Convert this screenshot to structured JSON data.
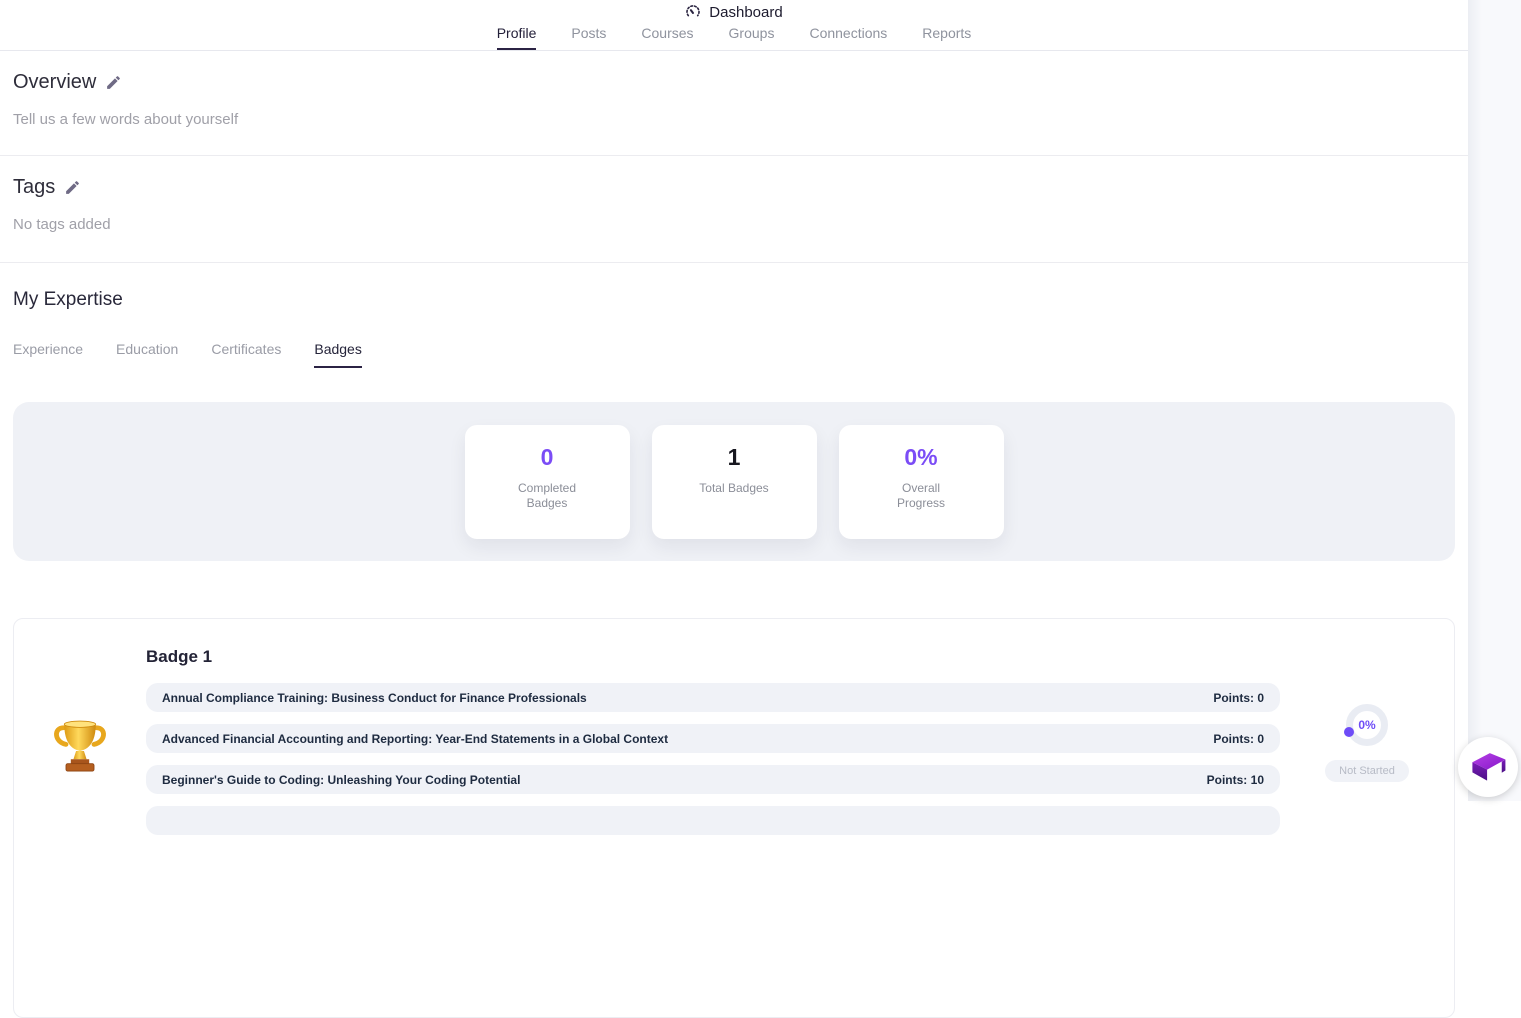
{
  "header": {
    "title": "Dashboard",
    "tabs": [
      {
        "label": "Profile"
      },
      {
        "label": "Posts"
      },
      {
        "label": "Courses"
      },
      {
        "label": "Groups"
      },
      {
        "label": "Connections"
      },
      {
        "label": "Reports"
      }
    ]
  },
  "overview": {
    "title": "Overview",
    "subtitle": "Tell us a few words about yourself"
  },
  "tags": {
    "title": "Tags",
    "empty_text": "No tags added"
  },
  "expertise": {
    "title": "My Expertise",
    "tabs": [
      {
        "label": "Experience"
      },
      {
        "label": "Education"
      },
      {
        "label": "Certificates"
      },
      {
        "label": "Badges"
      }
    ],
    "stats": [
      {
        "value": "0",
        "label": "Completed Badges"
      },
      {
        "value": "1",
        "label": "Total Badges"
      },
      {
        "value": "0%",
        "label": "Overall Progress"
      }
    ]
  },
  "badge": {
    "title": "Badge 1",
    "courses": [
      {
        "title": "Annual Compliance Training: Business Conduct for Finance Professionals",
        "points": "Points: 0"
      },
      {
        "title": "Advanced Financial Accounting and Reporting: Year-End Statements in a Global Context",
        "points": "Points: 0"
      },
      {
        "title": "Beginner's Guide to Coding: Unleashing Your Coding Potential",
        "points": "Points: 10"
      }
    ],
    "progress": {
      "percent": "0%",
      "status": "Not Started"
    }
  },
  "colors": {
    "accent": "#7b4cf6",
    "dark": "#17171f",
    "row_bg": "#f0f2f7"
  }
}
